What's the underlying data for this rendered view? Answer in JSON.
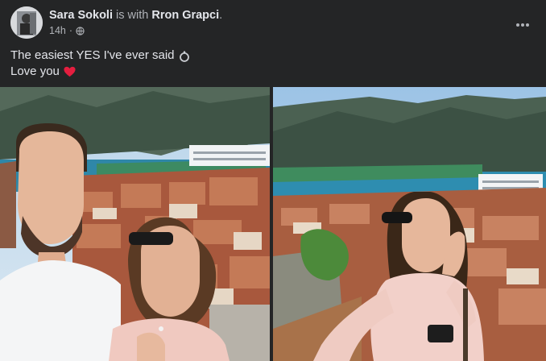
{
  "post": {
    "author": "Sara Sokoli",
    "with_text": "is with",
    "tagged": "Rron Grapci",
    "tagged_suffix": ".",
    "time": "14h",
    "separator": "·",
    "privacy_icon": "globe-icon",
    "caption_line1": "The easiest YES I've ever said",
    "caption_line1_emoji": "ring-icon",
    "caption_line2": "Love you",
    "caption_line2_emoji": "heart-icon"
  },
  "photos": [
    {
      "name": "selfie-photo-left",
      "scene": "couple selfie over Kotor bay"
    },
    {
      "name": "selfie-photo-right",
      "scene": "woman showing ring over Kotor bay"
    }
  ],
  "colors": {
    "background": "#242526",
    "text": "#e4e6eb",
    "secondary_text": "#b0b3b8",
    "heart": "#e41e3f"
  }
}
